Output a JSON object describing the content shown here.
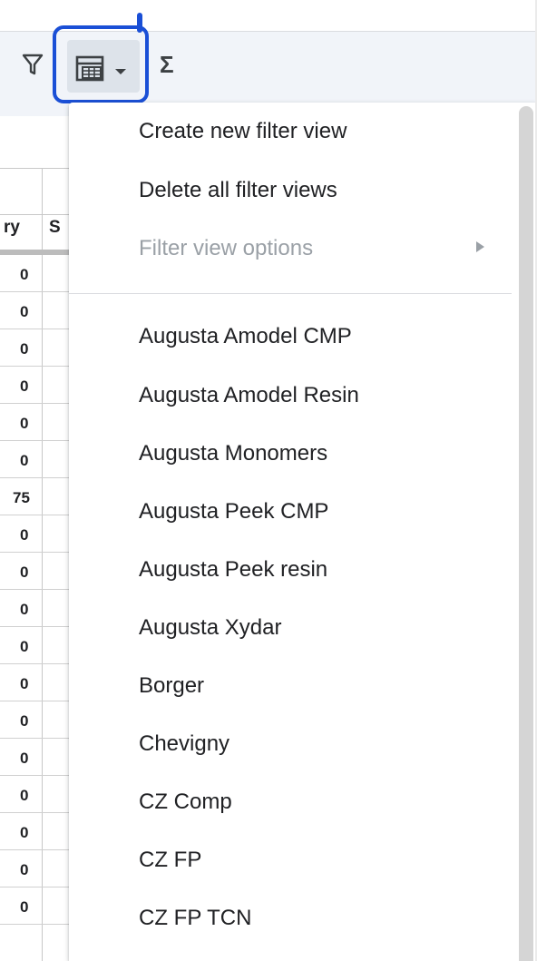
{
  "toolbar": {
    "filter_icon": "filter-icon",
    "filter_views_icon": "filter-views-grid-icon",
    "dropdown_icon": "caret-down-icon",
    "functions_label": "Σ"
  },
  "sheet": {
    "column_headers": [
      "ry",
      "S"
    ],
    "cells": [
      "0",
      "0",
      "0",
      "0",
      "0",
      "0",
      "75",
      "0",
      "0",
      "0",
      "0",
      "0",
      "0",
      "0",
      "0",
      "0",
      "0",
      "0"
    ]
  },
  "menu": {
    "create_label": "Create new filter view",
    "delete_label": "Delete all filter views",
    "options_label": "Filter view options",
    "views": [
      "Augusta Amodel CMP",
      "Augusta Amodel Resin",
      "Augusta Monomers",
      "Augusta Peek CMP",
      "Augusta Peek resin",
      "Augusta Xydar",
      "Borger",
      "Chevigny",
      "CZ Comp",
      "CZ FP",
      "CZ FP TCN"
    ]
  },
  "colors": {
    "annotation": "#1a4fd6",
    "toolbar_bg": "#f1f4f9",
    "active_button_bg": "#dde3ea",
    "disabled_text": "#9aa0a6"
  }
}
